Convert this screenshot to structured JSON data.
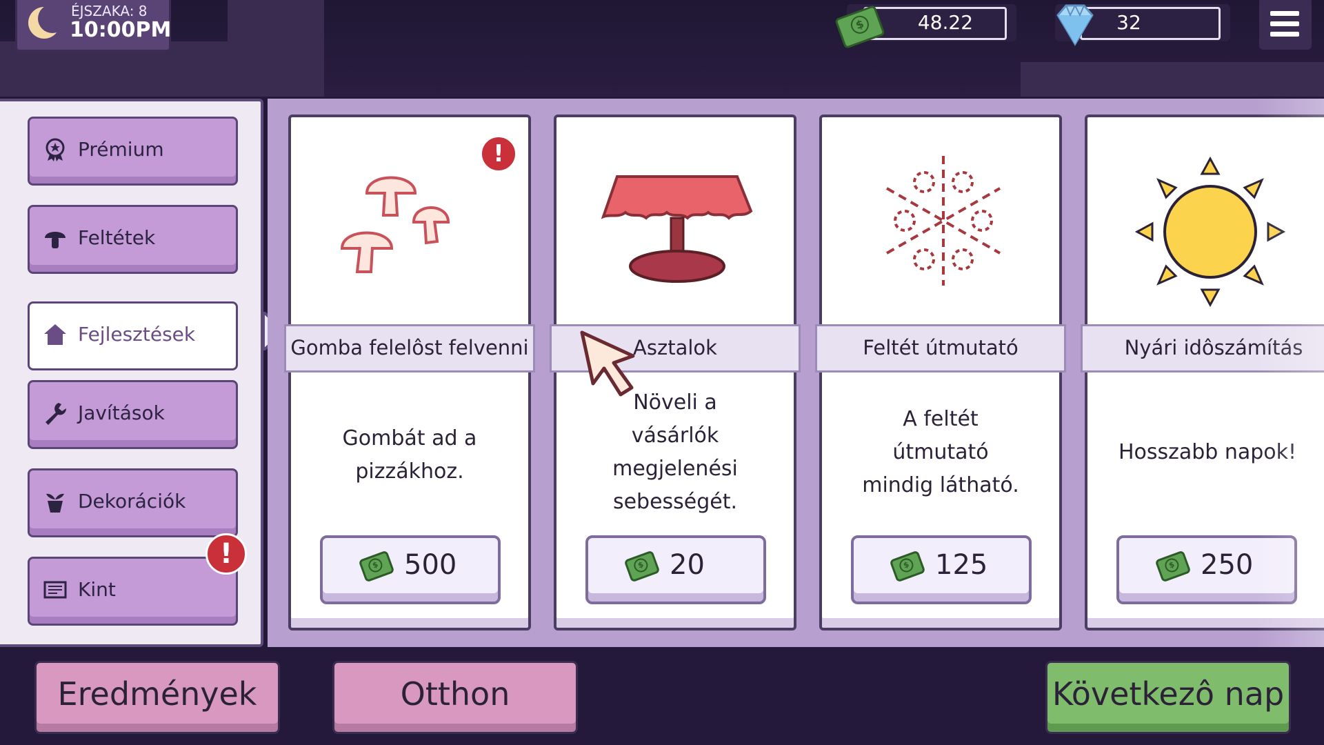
{
  "hud": {
    "night_label": "ÉJSZAKA: 8",
    "time": "10:00PM",
    "money": "48.22",
    "gems": "32"
  },
  "sidebar": {
    "items": [
      {
        "label": "Prémium",
        "icon": "premium-badge-icon"
      },
      {
        "label": "Feltétek",
        "icon": "mushroom-icon"
      },
      {
        "label": "Fejlesztések",
        "icon": "house-icon",
        "active": true
      },
      {
        "label": "Javítások",
        "icon": "wrench-icon"
      },
      {
        "label": "Dekorációk",
        "icon": "plant-pot-icon"
      },
      {
        "label": "Kint",
        "icon": "outdoor-sign-icon",
        "alert": "!"
      }
    ]
  },
  "cards": [
    {
      "title": "Gomba felelôst felvenni",
      "description": [
        "Gombát ad a",
        "pizzákhoz."
      ],
      "price": "500",
      "alert": "!"
    },
    {
      "title": "Asztalok",
      "description": [
        "Növeli a",
        "vásárlók",
        "megjelenési",
        "sebességét."
      ],
      "price": "20"
    },
    {
      "title": "Feltét útmutató",
      "description": [
        "A feltét",
        "útmutató",
        "mindig látható."
      ],
      "price": "125"
    },
    {
      "title": "Nyári idôszámítás",
      "description": [
        "Hosszabb napok!"
      ],
      "price": "250"
    }
  ],
  "bottom": {
    "results": "Eredmények",
    "home": "Otthon",
    "next_day": "Következô nap"
  },
  "colors": {
    "background": "#24193a",
    "button_purple": "#c49bd6",
    "button_pink": "#d898c0",
    "button_green": "#7fbd6c",
    "alert_red": "#c9303a"
  }
}
